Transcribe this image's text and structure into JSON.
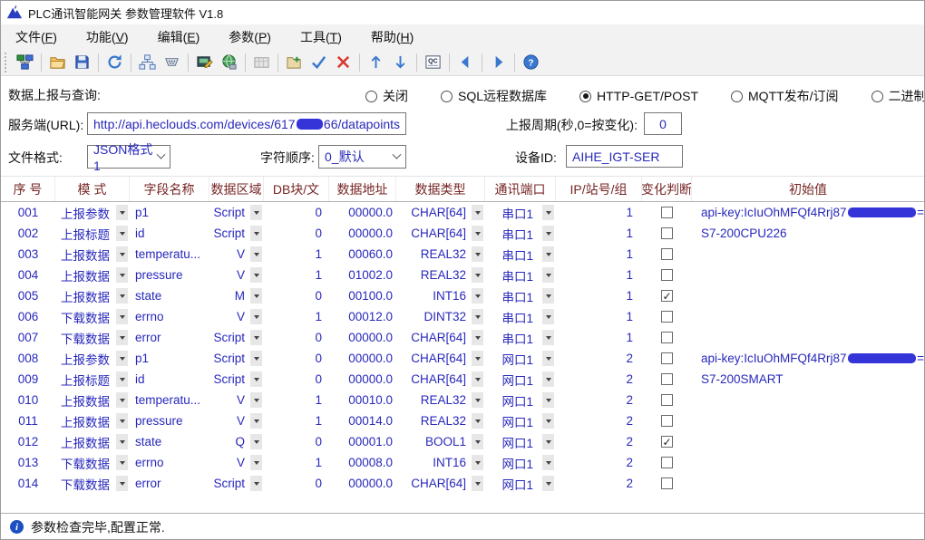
{
  "window": {
    "title": "PLC通讯智能网关 参数管理软件 V1.8"
  },
  "menu": {
    "items": [
      "文件(F)",
      "功能(V)",
      "编辑(E)",
      "参数(P)",
      "工具(T)",
      "帮助(H)"
    ]
  },
  "toolbar": {
    "items": [
      "grip",
      "connect-network",
      "|",
      "open-file",
      "save",
      "|",
      "refresh",
      "|",
      "topology",
      "serial-port",
      "|",
      "plc-edit",
      "web-globe",
      "|",
      "plc-table-disabled",
      "|",
      "add-group",
      "apply-check",
      "delete-x",
      "|",
      "move-up",
      "move-down",
      "|",
      "qc-code",
      "|",
      "prev",
      "|",
      "next",
      "|",
      "help"
    ]
  },
  "report": {
    "label": "数据上报与查询:",
    "options": [
      {
        "label": "关闭",
        "selected": false
      },
      {
        "label": "SQL远程数据库",
        "selected": false
      },
      {
        "label": "HTTP-GET/POST",
        "selected": true
      },
      {
        "label": "MQTT发布/订阅",
        "selected": false
      },
      {
        "label": "二进制协议收/发",
        "selected": false
      }
    ]
  },
  "server": {
    "label": "服务端(URL):",
    "url_prefix": "http://api.heclouds.com/devices/617",
    "url_redacted": true,
    "url_suffix": "66/datapoints",
    "period_label": "上报周期(秒,0=按变化):",
    "period_value": "0"
  },
  "format": {
    "label": "文件格式:",
    "value": "JSON格式1",
    "order_label": "字符顺序:",
    "order_value": "0_默认",
    "device_label": "设备ID:",
    "device_value": "AIHE_IGT-SER"
  },
  "table": {
    "headers": [
      "序 号",
      "模 式",
      "字段名称",
      "数据区域",
      "DB块/文",
      "数据地址",
      "数据类型",
      "通讯端口",
      "IP/站号/组",
      "变化判断",
      "初始值"
    ],
    "rows": [
      {
        "seq": "001",
        "mode": "上报参数",
        "field": "p1",
        "area": "Script",
        "db": "0",
        "addr": "00000.0",
        "dtype": "CHAR[64]",
        "port": "串口1",
        "station": "1",
        "changed": false,
        "init": "api-key:IcIuOhMFQf4Rrj87",
        "init_redacted": true,
        "init_suffix": "="
      },
      {
        "seq": "002",
        "mode": "上报标题",
        "field": "id",
        "area": "Script",
        "db": "0",
        "addr": "00000.0",
        "dtype": "CHAR[64]",
        "port": "串口1",
        "station": "1",
        "changed": false,
        "init": "S7-200CPU226",
        "init_redacted": false,
        "init_suffix": ""
      },
      {
        "seq": "003",
        "mode": "上报数据",
        "field": "temperatu...",
        "area": "V",
        "db": "1",
        "addr": "00060.0",
        "dtype": "REAL32",
        "port": "串口1",
        "station": "1",
        "changed": false,
        "init": "",
        "init_redacted": false,
        "init_suffix": ""
      },
      {
        "seq": "004",
        "mode": "上报数据",
        "field": "pressure",
        "area": "V",
        "db": "1",
        "addr": "01002.0",
        "dtype": "REAL32",
        "port": "串口1",
        "station": "1",
        "changed": false,
        "init": "",
        "init_redacted": false,
        "init_suffix": ""
      },
      {
        "seq": "005",
        "mode": "上报数据",
        "field": "state",
        "area": "M",
        "db": "0",
        "addr": "00100.0",
        "dtype": "INT16",
        "port": "串口1",
        "station": "1",
        "changed": true,
        "init": "",
        "init_redacted": false,
        "init_suffix": ""
      },
      {
        "seq": "006",
        "mode": "下载数据",
        "field": "errno",
        "area": "V",
        "db": "1",
        "addr": "00012.0",
        "dtype": "DINT32",
        "port": "串口1",
        "station": "1",
        "changed": false,
        "init": "",
        "init_redacted": false,
        "init_suffix": ""
      },
      {
        "seq": "007",
        "mode": "下载数据",
        "field": "error",
        "area": "Script",
        "db": "0",
        "addr": "00000.0",
        "dtype": "CHAR[64]",
        "port": "串口1",
        "station": "1",
        "changed": false,
        "init": "",
        "init_redacted": false,
        "init_suffix": ""
      },
      {
        "seq": "008",
        "mode": "上报参数",
        "field": "p1",
        "area": "Script",
        "db": "0",
        "addr": "00000.0",
        "dtype": "CHAR[64]",
        "port": "网口1",
        "station": "2",
        "changed": false,
        "init": "api-key:IcIuOhMFQf4Rrj87",
        "init_redacted": true,
        "init_suffix": "="
      },
      {
        "seq": "009",
        "mode": "上报标题",
        "field": "id",
        "area": "Script",
        "db": "0",
        "addr": "00000.0",
        "dtype": "CHAR[64]",
        "port": "网口1",
        "station": "2",
        "changed": false,
        "init": "S7-200SMART",
        "init_redacted": false,
        "init_suffix": ""
      },
      {
        "seq": "010",
        "mode": "上报数据",
        "field": "temperatu...",
        "area": "V",
        "db": "1",
        "addr": "00010.0",
        "dtype": "REAL32",
        "port": "网口1",
        "station": "2",
        "changed": false,
        "init": "",
        "init_redacted": false,
        "init_suffix": ""
      },
      {
        "seq": "011",
        "mode": "上报数据",
        "field": "pressure",
        "area": "V",
        "db": "1",
        "addr": "00014.0",
        "dtype": "REAL32",
        "port": "网口1",
        "station": "2",
        "changed": false,
        "init": "",
        "init_redacted": false,
        "init_suffix": ""
      },
      {
        "seq": "012",
        "mode": "上报数据",
        "field": "state",
        "area": "Q",
        "db": "0",
        "addr": "00001.0",
        "dtype": "BOOL1",
        "port": "网口1",
        "station": "2",
        "changed": true,
        "init": "",
        "init_redacted": false,
        "init_suffix": ""
      },
      {
        "seq": "013",
        "mode": "下载数据",
        "field": "errno",
        "area": "V",
        "db": "1",
        "addr": "00008.0",
        "dtype": "INT16",
        "port": "网口1",
        "station": "2",
        "changed": false,
        "init": "",
        "init_redacted": false,
        "init_suffix": ""
      },
      {
        "seq": "014",
        "mode": "下载数据",
        "field": "error",
        "area": "Script",
        "db": "0",
        "addr": "00000.0",
        "dtype": "CHAR[64]",
        "port": "网口1",
        "station": "2",
        "changed": false,
        "init": "",
        "init_redacted": false,
        "init_suffix": ""
      }
    ]
  },
  "statusbar": {
    "text": "参数检查完毕,配置正常."
  },
  "colors": {
    "table_text": "#2828bc",
    "header_text": "#772525",
    "accent_blue": "#3a78cf",
    "status_icon": "#1d4fc0"
  }
}
